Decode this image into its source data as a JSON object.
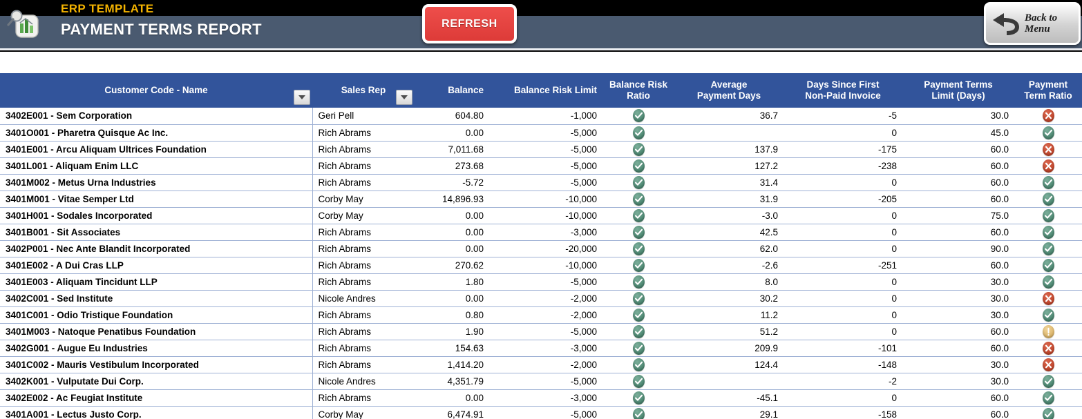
{
  "header": {
    "brand_tag": "ERP TEMPLATE",
    "title": "PAYMENT TERMS REPORT",
    "app_icon": "chart-magnifier-icon",
    "refresh_label": "REFRESH",
    "back_line1": "Back to",
    "back_line2": "Menu",
    "colors": {
      "banner_black": "#000000",
      "banner_slate": "#4a5a70",
      "brand_gold": "#f5b400",
      "refresh_red": "#dd3b38",
      "table_header_blue": "#32549b",
      "row_tint": "#d9def0",
      "grid_line": "#9db0d4",
      "status_ok": "#4b8670",
      "status_bad": "#c1452b",
      "status_warn": "#dcb56a"
    }
  },
  "table": {
    "columns": [
      {
        "label": "Customer Code - Name",
        "filter": true
      },
      {
        "label": "Sales Rep",
        "filter": true
      },
      {
        "label": "Balance",
        "filter": false
      },
      {
        "label": "Balance Risk Limit",
        "filter": false
      },
      {
        "label_line1": "Balance Risk",
        "label_line2": "Ratio",
        "filter": false
      },
      {
        "label_line1": "Average",
        "label_line2": "Payment Days",
        "filter": false
      },
      {
        "label_line1": "Days Since First",
        "label_line2": "Non-Paid Invoice",
        "filter": false
      },
      {
        "label_line1": "Payment Terms",
        "label_line2": "Limit (Days)",
        "filter": false
      },
      {
        "label_line1": "Payment",
        "label_line2": "Term Ratio",
        "filter": false
      }
    ],
    "rows": [
      {
        "customer": "3402E001 - Sem Corporation",
        "rep": "Geri Pell",
        "balance": "604.80",
        "risk_limit": "-1,000",
        "risk_ratio": "ok",
        "avg_days": "36.7",
        "days_since": "-5",
        "terms_limit": "30.0",
        "term_ratio": "bad"
      },
      {
        "customer": "3401O001 - Pharetra Quisque Ac Inc.",
        "rep": "Rich Abrams",
        "balance": "0.00",
        "risk_limit": "-5,000",
        "risk_ratio": "ok",
        "avg_days": "",
        "days_since": "0",
        "terms_limit": "45.0",
        "term_ratio": "ok"
      },
      {
        "customer": "3401E001 - Arcu Aliquam Ultrices Foundation",
        "rep": "Rich Abrams",
        "balance": "7,011.68",
        "risk_limit": "-5,000",
        "risk_ratio": "ok",
        "avg_days": "137.9",
        "days_since": "-175",
        "terms_limit": "60.0",
        "term_ratio": "bad"
      },
      {
        "customer": "3401L001 - Aliquam Enim LLC",
        "rep": "Rich Abrams",
        "balance": "273.68",
        "risk_limit": "-5,000",
        "risk_ratio": "ok",
        "avg_days": "127.2",
        "days_since": "-238",
        "terms_limit": "60.0",
        "term_ratio": "bad"
      },
      {
        "customer": "3401M002 - Metus Urna Industries",
        "rep": "Rich Abrams",
        "balance": "-5.72",
        "risk_limit": "-5,000",
        "risk_ratio": "ok",
        "avg_days": "31.4",
        "days_since": "0",
        "terms_limit": "60.0",
        "term_ratio": "ok"
      },
      {
        "customer": "3401M001 - Vitae Semper Ltd",
        "rep": "Corby May",
        "balance": "14,896.93",
        "risk_limit": "-10,000",
        "risk_ratio": "ok",
        "avg_days": "31.9",
        "days_since": "-205",
        "terms_limit": "60.0",
        "term_ratio": "ok"
      },
      {
        "customer": "3401H001 - Sodales Incorporated",
        "rep": "Corby May",
        "balance": "0.00",
        "risk_limit": "-10,000",
        "risk_ratio": "ok",
        "avg_days": "-3.0",
        "days_since": "0",
        "terms_limit": "75.0",
        "term_ratio": "ok"
      },
      {
        "customer": "3401B001 - Sit Associates",
        "rep": "Rich Abrams",
        "balance": "0.00",
        "risk_limit": "-3,000",
        "risk_ratio": "ok",
        "avg_days": "42.5",
        "days_since": "0",
        "terms_limit": "60.0",
        "term_ratio": "ok"
      },
      {
        "customer": "3402P001 - Nec Ante Blandit Incorporated",
        "rep": "Rich Abrams",
        "balance": "0.00",
        "risk_limit": "-20,000",
        "risk_ratio": "ok",
        "avg_days": "62.0",
        "days_since": "0",
        "terms_limit": "90.0",
        "term_ratio": "ok"
      },
      {
        "customer": "3401E002 - A Dui Cras LLP",
        "rep": "Rich Abrams",
        "balance": "270.62",
        "risk_limit": "-10,000",
        "risk_ratio": "ok",
        "avg_days": "-2.6",
        "days_since": "-251",
        "terms_limit": "60.0",
        "term_ratio": "ok"
      },
      {
        "customer": "3401E003 - Aliquam Tincidunt LLP",
        "rep": "Rich Abrams",
        "balance": "1.80",
        "risk_limit": "-5,000",
        "risk_ratio": "ok",
        "avg_days": "8.0",
        "days_since": "0",
        "terms_limit": "30.0",
        "term_ratio": "ok"
      },
      {
        "customer": "3402C001 - Sed Institute",
        "rep": "Nicole Andres",
        "balance": "0.00",
        "risk_limit": "-2,000",
        "risk_ratio": "ok",
        "avg_days": "30.2",
        "days_since": "0",
        "terms_limit": "30.0",
        "term_ratio": "bad"
      },
      {
        "customer": "3401C001 - Odio Tristique Foundation",
        "rep": "Rich Abrams",
        "balance": "0.80",
        "risk_limit": "-2,000",
        "risk_ratio": "ok",
        "avg_days": "11.2",
        "days_since": "0",
        "terms_limit": "30.0",
        "term_ratio": "ok"
      },
      {
        "customer": "3401M003 - Natoque Penatibus Foundation",
        "rep": "Rich Abrams",
        "balance": "1.90",
        "risk_limit": "-5,000",
        "risk_ratio": "ok",
        "avg_days": "51.2",
        "days_since": "0",
        "terms_limit": "60.0",
        "term_ratio": "warn"
      },
      {
        "customer": "3402G001 - Augue Eu Industries",
        "rep": "Rich Abrams",
        "balance": "154.63",
        "risk_limit": "-3,000",
        "risk_ratio": "ok",
        "avg_days": "209.9",
        "days_since": "-101",
        "terms_limit": "60.0",
        "term_ratio": "bad"
      },
      {
        "customer": "3401C002 - Mauris Vestibulum Incorporated",
        "rep": "Rich Abrams",
        "balance": "1,414.20",
        "risk_limit": "-2,000",
        "risk_ratio": "ok",
        "avg_days": "124.4",
        "days_since": "-148",
        "terms_limit": "30.0",
        "term_ratio": "bad"
      },
      {
        "customer": "3402K001 - Vulputate Dui Corp.",
        "rep": "Nicole Andres",
        "balance": "4,351.79",
        "risk_limit": "-5,000",
        "risk_ratio": "ok",
        "avg_days": "",
        "days_since": "-2",
        "terms_limit": "30.0",
        "term_ratio": "ok"
      },
      {
        "customer": "3402E002 - Ac Feugiat Institute",
        "rep": "Rich Abrams",
        "balance": "0.00",
        "risk_limit": "-3,000",
        "risk_ratio": "ok",
        "avg_days": "-45.1",
        "days_since": "0",
        "terms_limit": "60.0",
        "term_ratio": "ok"
      },
      {
        "customer": "3401A001 - Lectus Justo Corp.",
        "rep": "Corby May",
        "balance": "6,474.91",
        "risk_limit": "-5,000",
        "risk_ratio": "ok",
        "avg_days": "29.1",
        "days_since": "-158",
        "terms_limit": "60.0",
        "term_ratio": "ok"
      }
    ]
  }
}
